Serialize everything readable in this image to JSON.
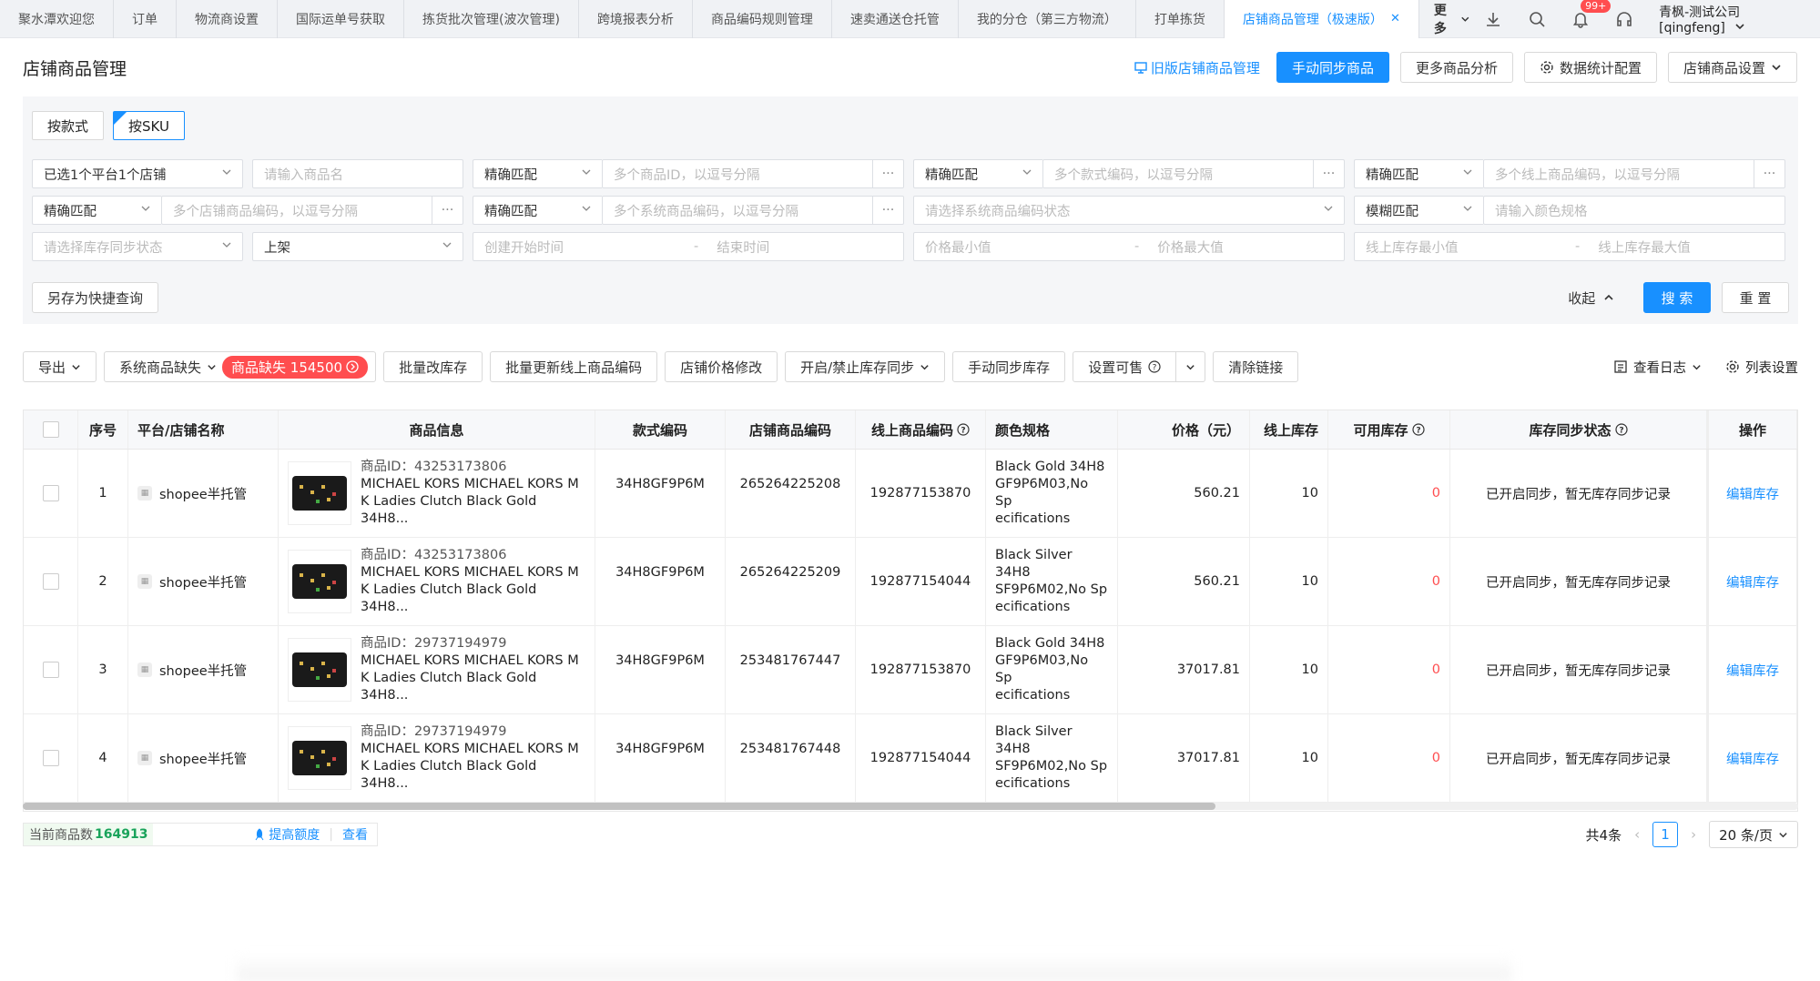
{
  "tabs": [
    {
      "label": "聚水潭欢迎您",
      "active": false
    },
    {
      "label": "订单",
      "active": false
    },
    {
      "label": "物流商设置",
      "active": false
    },
    {
      "label": "国际运单号获取",
      "active": false
    },
    {
      "label": "拣货批次管理(波次管理)",
      "active": false
    },
    {
      "label": "跨境报表分析",
      "active": false
    },
    {
      "label": "商品编码规则管理",
      "active": false
    },
    {
      "label": "速卖通送仓托管",
      "active": false
    },
    {
      "label": "我的分仓（第三方物流）",
      "active": false
    },
    {
      "label": "打单拣货",
      "active": false
    },
    {
      "label": "店铺商品管理（极速版）",
      "active": true
    }
  ],
  "tab_more": "更多",
  "notif_badge": "99+",
  "user": "青枫-测试公司[qingfeng]",
  "header": {
    "title": "店铺商品管理",
    "old_link": "旧版店铺商品管理",
    "btn_sync": "手动同步商品",
    "btn_analysis": "更多商品分析",
    "btn_stats": "数据统计配置",
    "btn_settings": "店铺商品设置"
  },
  "mode": {
    "style": "按款式",
    "sku": "按SKU"
  },
  "filters": {
    "store": "已选1个平台1个店铺",
    "name_ph": "请输入商品名",
    "match_exact": "精确匹配",
    "match_fuzzy": "模糊匹配",
    "ids_ph": "多个商品ID，以逗号分隔",
    "style_codes_ph": "多个款式编码，以逗号分隔",
    "online_codes_ph": "多个线上商品编码，以逗号分隔",
    "store_codes_ph": "多个店铺商品编码，以逗号分隔",
    "sys_codes_ph": "多个系统商品编码，以逗号分隔",
    "sys_status_ph": "请选择系统商品编码状态",
    "color_ph": "请输入颜色规格",
    "stock_sync_ph": "请选择库存同步状态",
    "listing": "上架",
    "create_start": "创建开始时间",
    "create_end": "结束时间",
    "price_min": "价格最小值",
    "price_max": "价格最大值",
    "stock_min": "线上库存最小值",
    "stock_max": "线上库存最大值",
    "save_query": "另存为快捷查询",
    "collapse": "收起",
    "search": "搜 索",
    "reset": "重 置"
  },
  "toolbar": {
    "export": "导出",
    "sys_missing": "系统商品缺失",
    "missing_badge": "商品缺失 154500",
    "bulk_stock": "批量改库存",
    "bulk_update_code": "批量更新线上商品编码",
    "price_change": "店铺价格修改",
    "toggle_sync": "开启/禁止库存同步",
    "manual_sync_stock": "手动同步库存",
    "set_sellable": "设置可售",
    "clear_link": "清除链接",
    "view_log": "查看日志",
    "col_settings": "列表设置"
  },
  "columns": [
    "序号",
    "平台/店铺名称",
    "商品信息",
    "款式编码",
    "店铺商品编码",
    "线上商品编码",
    "颜色规格",
    "价格（元）",
    "线上库存",
    "可用库存",
    "库存同步状态",
    "操作"
  ],
  "rows": [
    {
      "no": "1",
      "store": "shopee半托管",
      "pid": "商品ID：43253173806",
      "title1": "MICHAEL KORS MICHAEL KORS M",
      "title2": "K Ladies Clutch Black Gold 34H8...",
      "style": "34H8GF9P6M",
      "store_code": "265264225208",
      "online_code": "192877153870",
      "spec1": "Black Gold 34H8",
      "spec2": "GF9P6M03,No Sp",
      "spec3": "ecifications",
      "price": "560.21",
      "online_stock": "10",
      "avail": "0",
      "sync": "已开启同步，暂无库存同步记录",
      "op": "编辑库存"
    },
    {
      "no": "2",
      "store": "shopee半托管",
      "pid": "商品ID：43253173806",
      "title1": "MICHAEL KORS MICHAEL KORS M",
      "title2": "K Ladies Clutch Black Gold 34H8...",
      "style": "34H8GF9P6M",
      "store_code": "265264225209",
      "online_code": "192877154044",
      "spec1": "Black Silver 34H8",
      "spec2": "SF9P6M02,No Sp",
      "spec3": "ecifications",
      "price": "560.21",
      "online_stock": "10",
      "avail": "0",
      "sync": "已开启同步，暂无库存同步记录",
      "op": "编辑库存"
    },
    {
      "no": "3",
      "store": "shopee半托管",
      "pid": "商品ID：29737194979",
      "title1": "MICHAEL KORS MICHAEL KORS M",
      "title2": "K Ladies Clutch Black Gold 34H8...",
      "style": "34H8GF9P6M",
      "store_code": "253481767447",
      "online_code": "192877153870",
      "spec1": "Black Gold 34H8",
      "spec2": "GF9P6M03,No Sp",
      "spec3": "ecifications",
      "price": "37017.81",
      "online_stock": "10",
      "avail": "0",
      "sync": "已开启同步，暂无库存同步记录",
      "op": "编辑库存"
    },
    {
      "no": "4",
      "store": "shopee半托管",
      "pid": "商品ID：29737194979",
      "title1": "MICHAEL KORS MICHAEL KORS M",
      "title2": "K Ladies Clutch Black Gold 34H8...",
      "style": "34H8GF9P6M",
      "store_code": "253481767448",
      "online_code": "192877154044",
      "spec1": "Black Silver 34H8",
      "spec2": "SF9P6M02,No Sp",
      "spec3": "ecifications",
      "price": "37017.81",
      "online_stock": "10",
      "avail": "0",
      "sync": "已开启同步，暂无库存同步记录",
      "op": "编辑库存"
    }
  ],
  "footer": {
    "count_label": "当前商品数",
    "count": "164913",
    "raise": "提高额度",
    "view": "查看",
    "total": "共4条",
    "page": "1",
    "page_size": "20 条/页"
  },
  "colors": {
    "primary": "#1890ff",
    "danger": "#ff4d4f",
    "success": "#19a35a"
  }
}
